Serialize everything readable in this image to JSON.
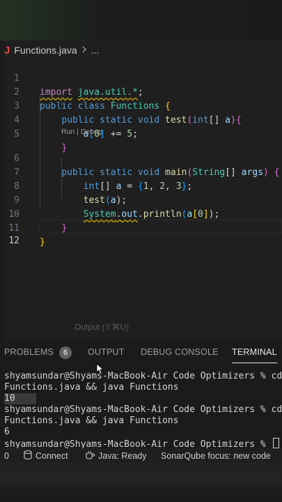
{
  "editor": {
    "breadcrumb": {
      "file": "Functions.java",
      "more": "..."
    },
    "lines": [
      {
        "n": "1"
      },
      {
        "n": "2"
      },
      {
        "n": "3"
      },
      {
        "n": "4"
      },
      {
        "n": "5"
      },
      {
        "n": "6"
      },
      {
        "n": "7"
      },
      {
        "n": "8"
      },
      {
        "n": "9"
      },
      {
        "n": "10"
      },
      {
        "n": "11"
      },
      {
        "n": "12"
      }
    ],
    "codelens": "Run | Debug",
    "code": {
      "l1": [
        "import",
        "java.util.*",
        ";"
      ],
      "l2": [
        "public",
        "class",
        "Functions",
        "{"
      ],
      "l3": [
        "public",
        "static",
        "void",
        "test",
        "(",
        "int",
        "[]",
        "a",
        ")",
        "{"
      ],
      "l4": [
        "a",
        "[",
        "0",
        "]",
        " += ",
        "5",
        ";"
      ],
      "l5": [
        "}"
      ],
      "l6": [
        "public",
        "static",
        "void",
        "main",
        "(",
        "String",
        "[]",
        "args",
        ")",
        "{"
      ],
      "l7": [
        "int",
        "[]",
        "a",
        " = ",
        "{",
        "1",
        ", ",
        "2",
        ", ",
        "3",
        "}",
        ";"
      ],
      "l8": [
        "test",
        "(",
        "a",
        ");"
      ],
      "l9": [
        "System",
        ".",
        "out",
        ".",
        "println",
        "(",
        "a",
        "[",
        "0",
        "]",
        ");"
      ],
      "l10": [
        "}"
      ],
      "l11": [
        "}"
      ]
    }
  },
  "output_hint": "Output (⇧⌘U)",
  "panel": {
    "tabs": [
      {
        "label": "PROBLEMS",
        "badge": "6"
      },
      {
        "label": "OUTPUT"
      },
      {
        "label": "DEBUG CONSOLE"
      },
      {
        "label": "TERMINAL",
        "active": true
      }
    ]
  },
  "terminal": {
    "lines": [
      "shyamsundar@Shyams-MacBook-Air Code Optimizers % cd \"",
      "Functions.java && java Functions",
      "10",
      "shyamsundar@Shyams-MacBook-Air Code Optimizers % cd \"",
      "Functions.java && java Functions",
      "6",
      "shyamsundar@Shyams-MacBook-Air Code Optimizers % "
    ]
  },
  "statusbar": {
    "problems_count": "0",
    "connect": "Connect",
    "java_status": "Java: Ready",
    "sonar": "SonarQube focus: new code"
  },
  "colors": {
    "keyword": "#569cd6",
    "import_keyword": "#c586c0",
    "type": "#4ec9b0",
    "function": "#dcdcaa",
    "variable": "#9cdcfe",
    "number": "#b5cea8",
    "java_icon": "#e8423f"
  },
  "icons": [
    "java-file-icon",
    "chevron-right-icon",
    "database-icon",
    "coffee-icon",
    "mouse-cursor-icon"
  ]
}
